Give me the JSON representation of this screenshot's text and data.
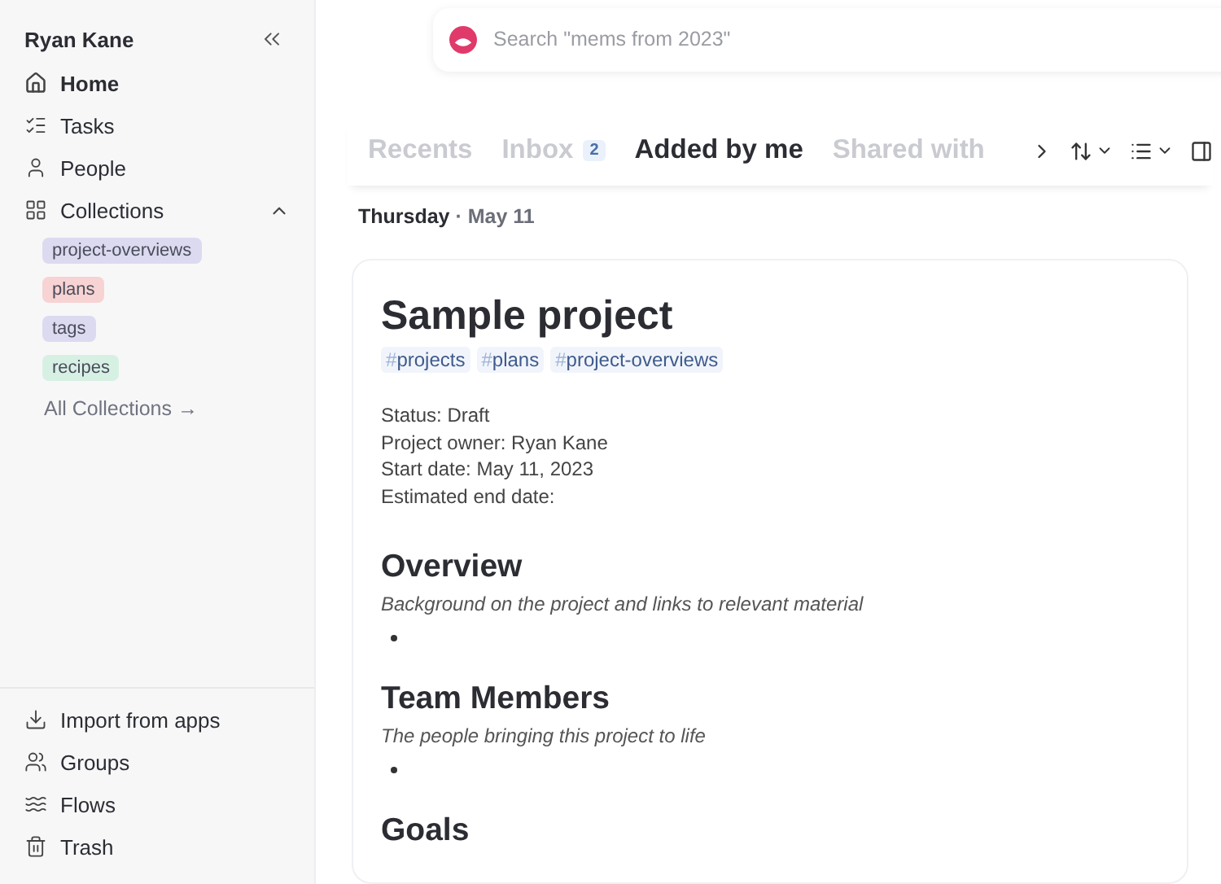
{
  "sidebar": {
    "user": "Ryan Kane",
    "nav": [
      {
        "label": "Home",
        "selected": true
      },
      {
        "label": "Tasks",
        "selected": false
      },
      {
        "label": "People",
        "selected": false
      }
    ],
    "collections": {
      "label": "Collections",
      "expanded": true,
      "tags": [
        {
          "label": "project-overviews",
          "color": "#dcdaf0"
        },
        {
          "label": "plans",
          "color": "#f7d3d3"
        },
        {
          "label": "tags",
          "color": "#dcdaf0"
        },
        {
          "label": "recipes",
          "color": "#d7f0e4"
        }
      ],
      "all_link": "All Collections →"
    },
    "bottom": [
      {
        "label": "Import from apps"
      },
      {
        "label": "Groups"
      },
      {
        "label": "Flows"
      },
      {
        "label": "Trash"
      }
    ]
  },
  "search": {
    "placeholder": "Search \"mems from 2023\""
  },
  "tabs": [
    {
      "label": "Recents",
      "selected": false
    },
    {
      "label": "Inbox",
      "badge": "2",
      "selected": false
    },
    {
      "label": "Added by me",
      "selected": true
    },
    {
      "label": "Shared with",
      "selected": false
    }
  ],
  "date": {
    "day": "Thursday",
    "rest": "· May 11"
  },
  "card": {
    "title": "Sample project",
    "tags": [
      {
        "hash": "#",
        "label": "projects"
      },
      {
        "hash": "#",
        "label": "plans"
      },
      {
        "hash": "#",
        "label": "project-overviews"
      }
    ],
    "fields": [
      "Status: Draft",
      "Project owner: Ryan Kane",
      "Start date: May 11, 2023",
      "Estimated end date:"
    ],
    "sections": [
      {
        "heading": "Overview",
        "description": "Background on the project and links to relevant material"
      },
      {
        "heading": "Team Members",
        "description": "The people bringing this project to life"
      },
      {
        "heading": "Goals"
      }
    ]
  }
}
